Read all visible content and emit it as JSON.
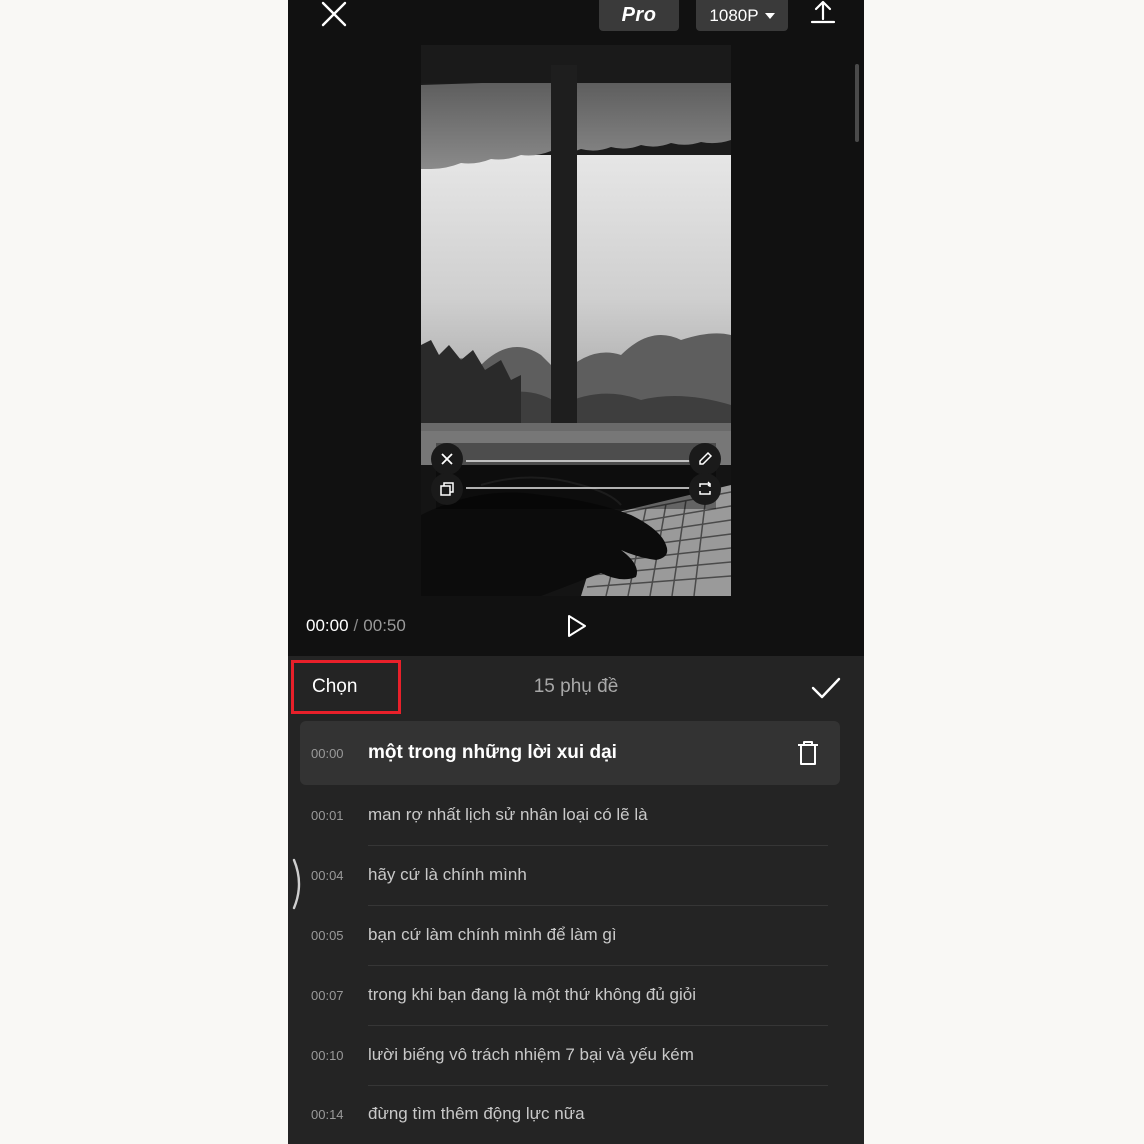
{
  "header": {
    "pro_label": "Pro",
    "resolution_label": "1080P"
  },
  "playback": {
    "current_time": "00:00",
    "separator": "/",
    "total_time": "00:50"
  },
  "panel": {
    "select_label": "Chọn",
    "subtitle_count": "15 phụ đề"
  },
  "subtitles": [
    {
      "time": "00:00",
      "text": "một trong những lời xui dại"
    },
    {
      "time": "00:01",
      "text": "man rợ nhất lịch sử nhân loại có lẽ là"
    },
    {
      "time": "00:04",
      "text": "hãy cứ là chính mình"
    },
    {
      "time": "00:05",
      "text": "bạn cứ làm chính mình để làm gì"
    },
    {
      "time": "00:07",
      "text": "trong khi bạn đang là một thứ không đủ giỏi"
    },
    {
      "time": "00:10",
      "text": "lười biếng vô trách nhiệm 7 bại và yếu kém"
    },
    {
      "time": "00:14",
      "text": "đừng tìm thêm động lực nữa"
    }
  ],
  "colors": {
    "highlight_box": "#e8202a",
    "background": "#111111",
    "panel": "#242424"
  },
  "icons": [
    "close-icon",
    "export-icon",
    "play-icon",
    "checkmark-icon",
    "trash-icon",
    "edit-icon",
    "duplicate-icon",
    "rotate-icon"
  ]
}
